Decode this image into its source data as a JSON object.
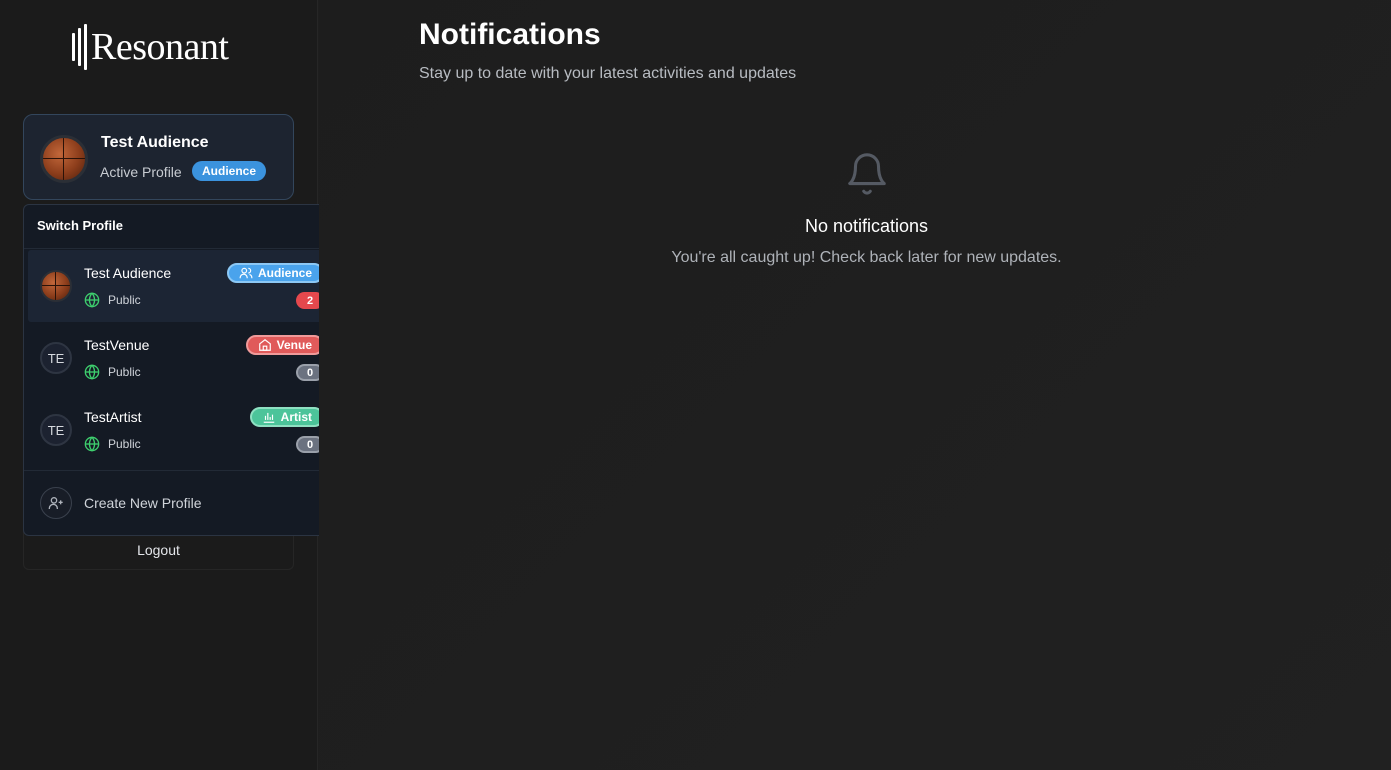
{
  "app": {
    "logo_text": "Resonant"
  },
  "active_profile": {
    "name": "Test Audience",
    "label": "Active Profile",
    "type_badge": "Audience",
    "badge_color": "#3b93de"
  },
  "switcher": {
    "title": "Switch Profile",
    "profiles": [
      {
        "name": "Test Audience",
        "visibility": "Public",
        "type": "Audience",
        "type_color": "#4aa3ec",
        "type_icon": "users-icon",
        "count": "2",
        "count_color": "#e5484d",
        "avatar": "basketball",
        "active": true
      },
      {
        "name": "TestVenue",
        "visibility": "Public",
        "type": "Venue",
        "type_color": "#e05a5a",
        "type_icon": "home-icon",
        "count": "0",
        "count_color": "#6b7280",
        "initials": "TE",
        "active": false
      },
      {
        "name": "TestArtist",
        "visibility": "Public",
        "type": "Artist",
        "type_color": "#4cc49a",
        "type_icon": "bar-chart-icon",
        "count": "0",
        "count_color": "#6b7280",
        "initials": "TE",
        "active": false
      }
    ],
    "create_label": "Create New Profile"
  },
  "logout_label": "Logout",
  "main": {
    "title": "Notifications",
    "subtitle": "Stay up to date with your latest activities and updates",
    "empty_title": "No notifications",
    "empty_text": "You're all caught up! Check back later for new updates."
  }
}
